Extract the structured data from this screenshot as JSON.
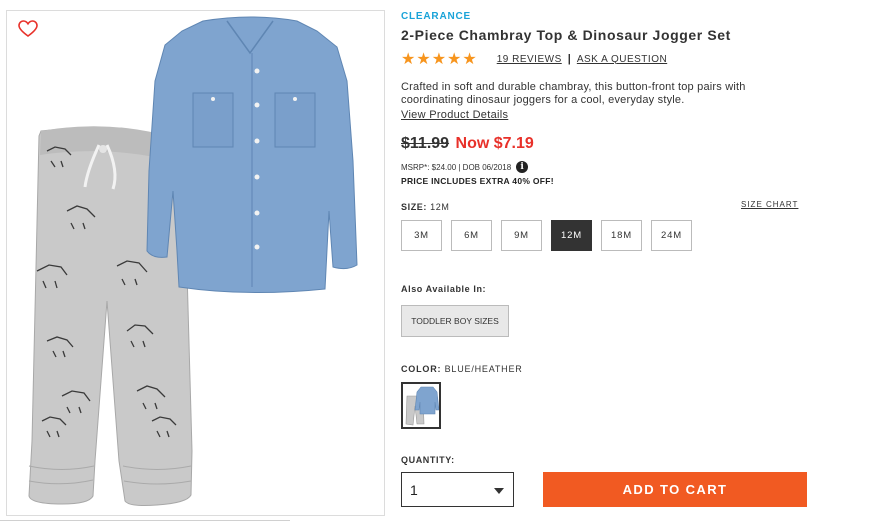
{
  "product": {
    "badge": "CLEARANCE",
    "title": "2-Piece Chambray Top & Dinosaur Jogger Set",
    "stars": "★★★★★",
    "reviews_link": "19 REVIEWS",
    "separator": "|",
    "ask_link": "ASK A QUESTION",
    "description": "Crafted in soft and durable chambray, this button-front top pairs with coordinating dinosaur joggers for a cool, everyday style.",
    "view_details": "View Product Details"
  },
  "pricing": {
    "old_price": "$11.99",
    "now_price": "Now $7.19",
    "msrp_text": "MSRP*: $24.00 | DOB 06/2018",
    "info_icon": "i",
    "extra_off": "PRICE INCLUDES EXTRA 40% OFF!"
  },
  "size": {
    "label": "SIZE:",
    "selected": "12M",
    "size_chart": "SIZE CHART",
    "options": [
      "3M",
      "6M",
      "9M",
      "12M",
      "18M",
      "24M"
    ]
  },
  "also_available": {
    "label": "Also Available In:",
    "button": "TODDLER BOY SIZES"
  },
  "color": {
    "label": "COLOR:",
    "value": "BLUE/HEATHER"
  },
  "quantity": {
    "label": "QUANTITY:",
    "value": "1"
  },
  "cart": {
    "button": "ADD TO CART"
  },
  "icons": {
    "favorite": "heart-outline-icon",
    "dropdown": "caret-down-icon",
    "info": "info-circle-icon"
  },
  "colors": {
    "accent_orange": "#f15a22",
    "sale_red": "#e8312a",
    "clearance_blue": "#1aa3d8",
    "star_orange": "#f7951e",
    "chambray_blue": "#7fa4cf",
    "heather_gray": "#c9c9c9"
  }
}
